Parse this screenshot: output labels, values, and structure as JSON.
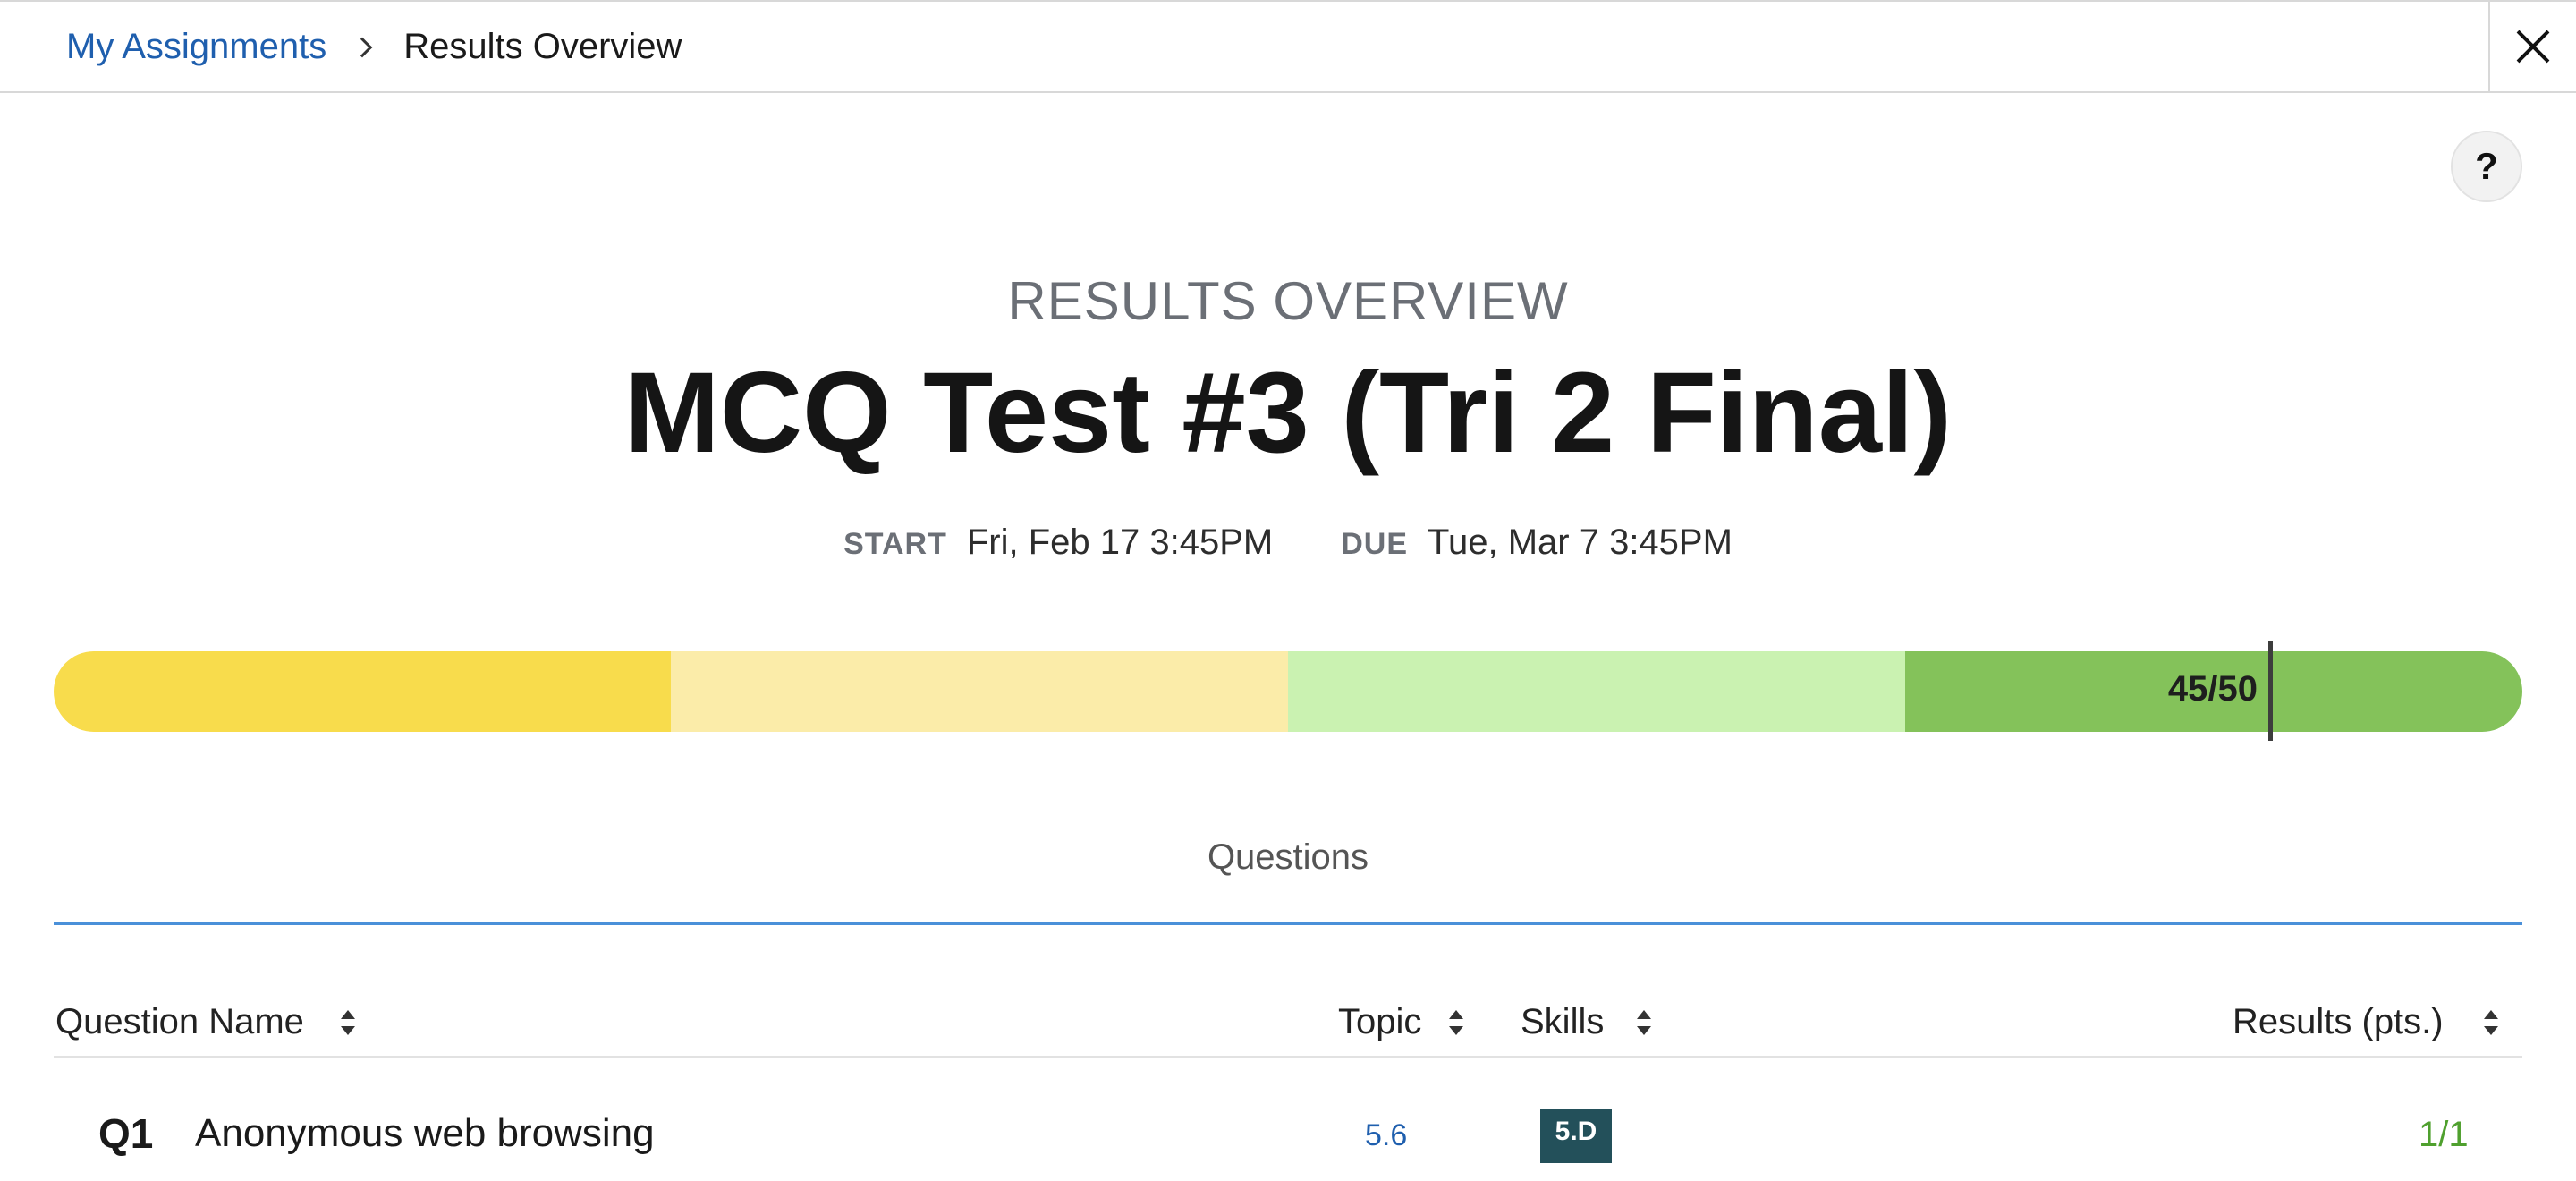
{
  "breadcrumb": {
    "parent": "My Assignments",
    "current": "Results Overview"
  },
  "help": {
    "label": "?"
  },
  "header": {
    "overline": "RESULTS OVERVIEW",
    "title": "MCQ Test #3 (Tri 2 Final)",
    "start_label": "START",
    "start_value": "Fri, Feb 17 3:45PM",
    "due_label": "DUE",
    "due_value": "Tue, Mar 7 3:45PM"
  },
  "score": {
    "label": "45/50",
    "earned": 45,
    "total": 50
  },
  "colors": {
    "link": "#1f5fae",
    "band_1": "#f8dc4c",
    "band_2": "#fbeca9",
    "band_3": "#caf2b1",
    "band_4": "#84c25a",
    "tab_underline": "#4a90d9",
    "skill_badge": "#23505a",
    "result_green": "#4fa02e"
  },
  "tabs": [
    {
      "label": "Questions",
      "active": true
    }
  ],
  "table": {
    "columns": [
      "Question Name",
      "Topic",
      "Skills",
      "Results (pts.)"
    ],
    "rows": [
      {
        "number": "Q1",
        "name": "Anonymous web browsing",
        "topic": "5.6",
        "skill": "5.D",
        "result": "1/1"
      }
    ]
  },
  "icons": [
    "chevron-right-icon",
    "close-icon",
    "sort-icon"
  ]
}
